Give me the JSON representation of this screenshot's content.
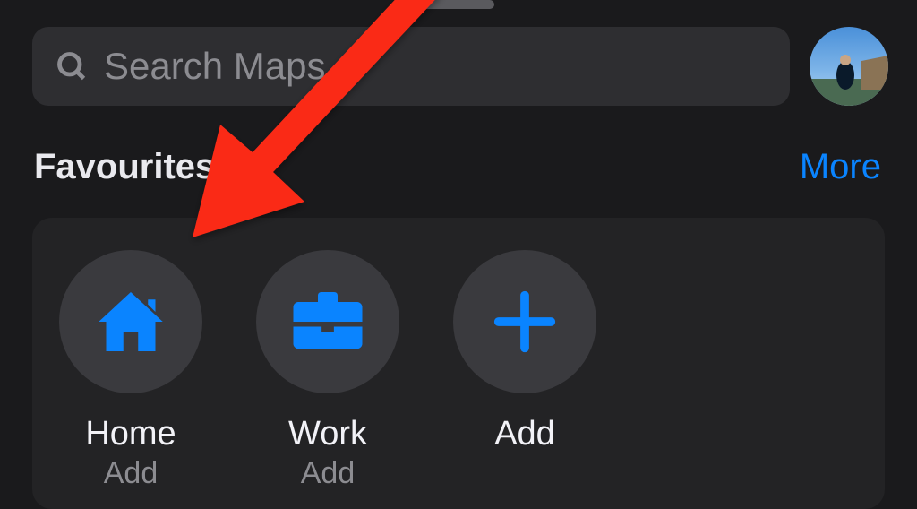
{
  "search": {
    "placeholder": "Search Maps"
  },
  "section": {
    "title": "Favourites",
    "more_label": "More"
  },
  "favourites": [
    {
      "label": "Home",
      "sublabel": "Add",
      "icon": "home"
    },
    {
      "label": "Work",
      "sublabel": "Add",
      "icon": "briefcase"
    },
    {
      "label": "Add",
      "sublabel": "",
      "icon": "plus"
    }
  ],
  "colors": {
    "accent": "#0a84ff",
    "bg": "#1a1a1c",
    "panel": "#232325",
    "circle": "#3a3a3e",
    "text_muted": "#8c8c91",
    "annotation": "#fa2a18"
  }
}
